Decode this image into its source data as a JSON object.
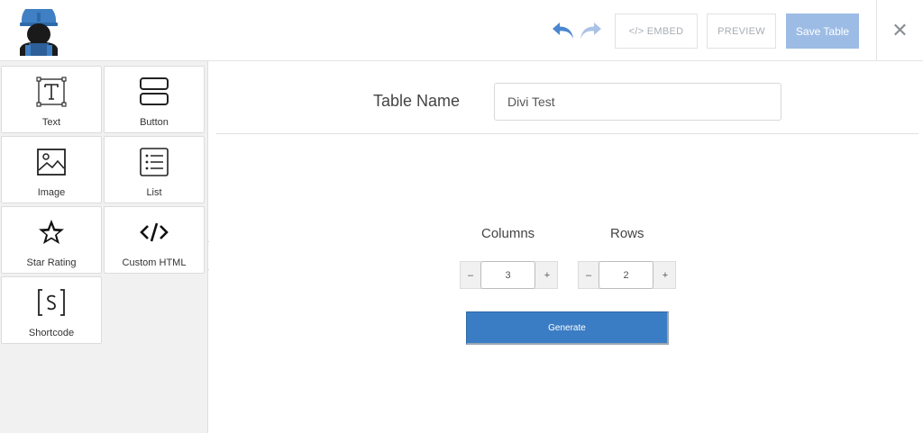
{
  "toolbar": {
    "embed_label": "</> EMBED",
    "preview_label": "PREVIEW",
    "save_label": "Save Table",
    "close_label": "✕"
  },
  "sidebar": {
    "items": [
      {
        "label": "Text",
        "icon": "text-icon"
      },
      {
        "label": "Button",
        "icon": "button-icon"
      },
      {
        "label": "Image",
        "icon": "image-icon"
      },
      {
        "label": "List",
        "icon": "list-icon"
      },
      {
        "label": "Star Rating",
        "icon": "star-icon"
      },
      {
        "label": "Custom HTML",
        "icon": "code-icon"
      },
      {
        "label": "Shortcode",
        "icon": "shortcode-icon"
      }
    ]
  },
  "form": {
    "table_name_label": "Table Name",
    "table_name_value": "Divi Test",
    "columns_label": "Columns",
    "columns_value": "3",
    "rows_label": "Rows",
    "rows_value": "2",
    "minus_label": "–",
    "plus_label": "+",
    "generate_label": "Generate"
  },
  "colors": {
    "accent": "#3b7dc4",
    "save_button": "#9dbce5",
    "undo": "#4a87cf",
    "redo": "#a9c3e6"
  }
}
